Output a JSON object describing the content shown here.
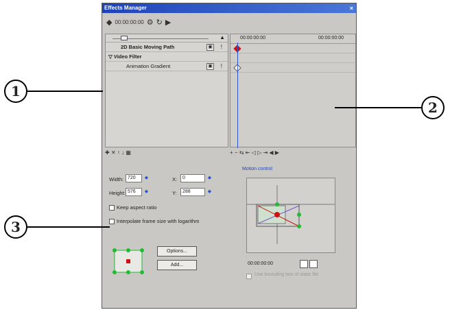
{
  "window": {
    "title": "Effects Manager",
    "close_glyph": "×"
  },
  "toolbar": {
    "timecode": "00:00:00:00"
  },
  "effects_list": {
    "effect_1": "2D Basic Moving Path",
    "group": "Video Filter",
    "effect_2": "Animation Gradient"
  },
  "timeline": {
    "ruler_start": "00:00:00:00",
    "ruler_end": "00:00:00:00"
  },
  "properties": {
    "width_label": "Width:",
    "width_value": "720",
    "height_label": "Height:",
    "height_value": "576",
    "x_label": "X:",
    "x_value": "0",
    "y_label": "Y:",
    "y_value": "288",
    "keep_aspect": "Keep aspect ratio",
    "interpolate": "Interpolate frame size with logarithm",
    "options_button": "Options...",
    "add_button": "Add..."
  },
  "motion_control": {
    "title": "Motion control",
    "timecode": "00:00:00:00",
    "disabled_option": "Use bounding box of static file"
  },
  "callouts": {
    "c1": "1",
    "c2": "2",
    "c3": "3"
  },
  "colors": {
    "title_bar": "#1f44b8",
    "keyframe": "#cc1111",
    "handle": "#22bb33",
    "link": "#2447b5"
  }
}
